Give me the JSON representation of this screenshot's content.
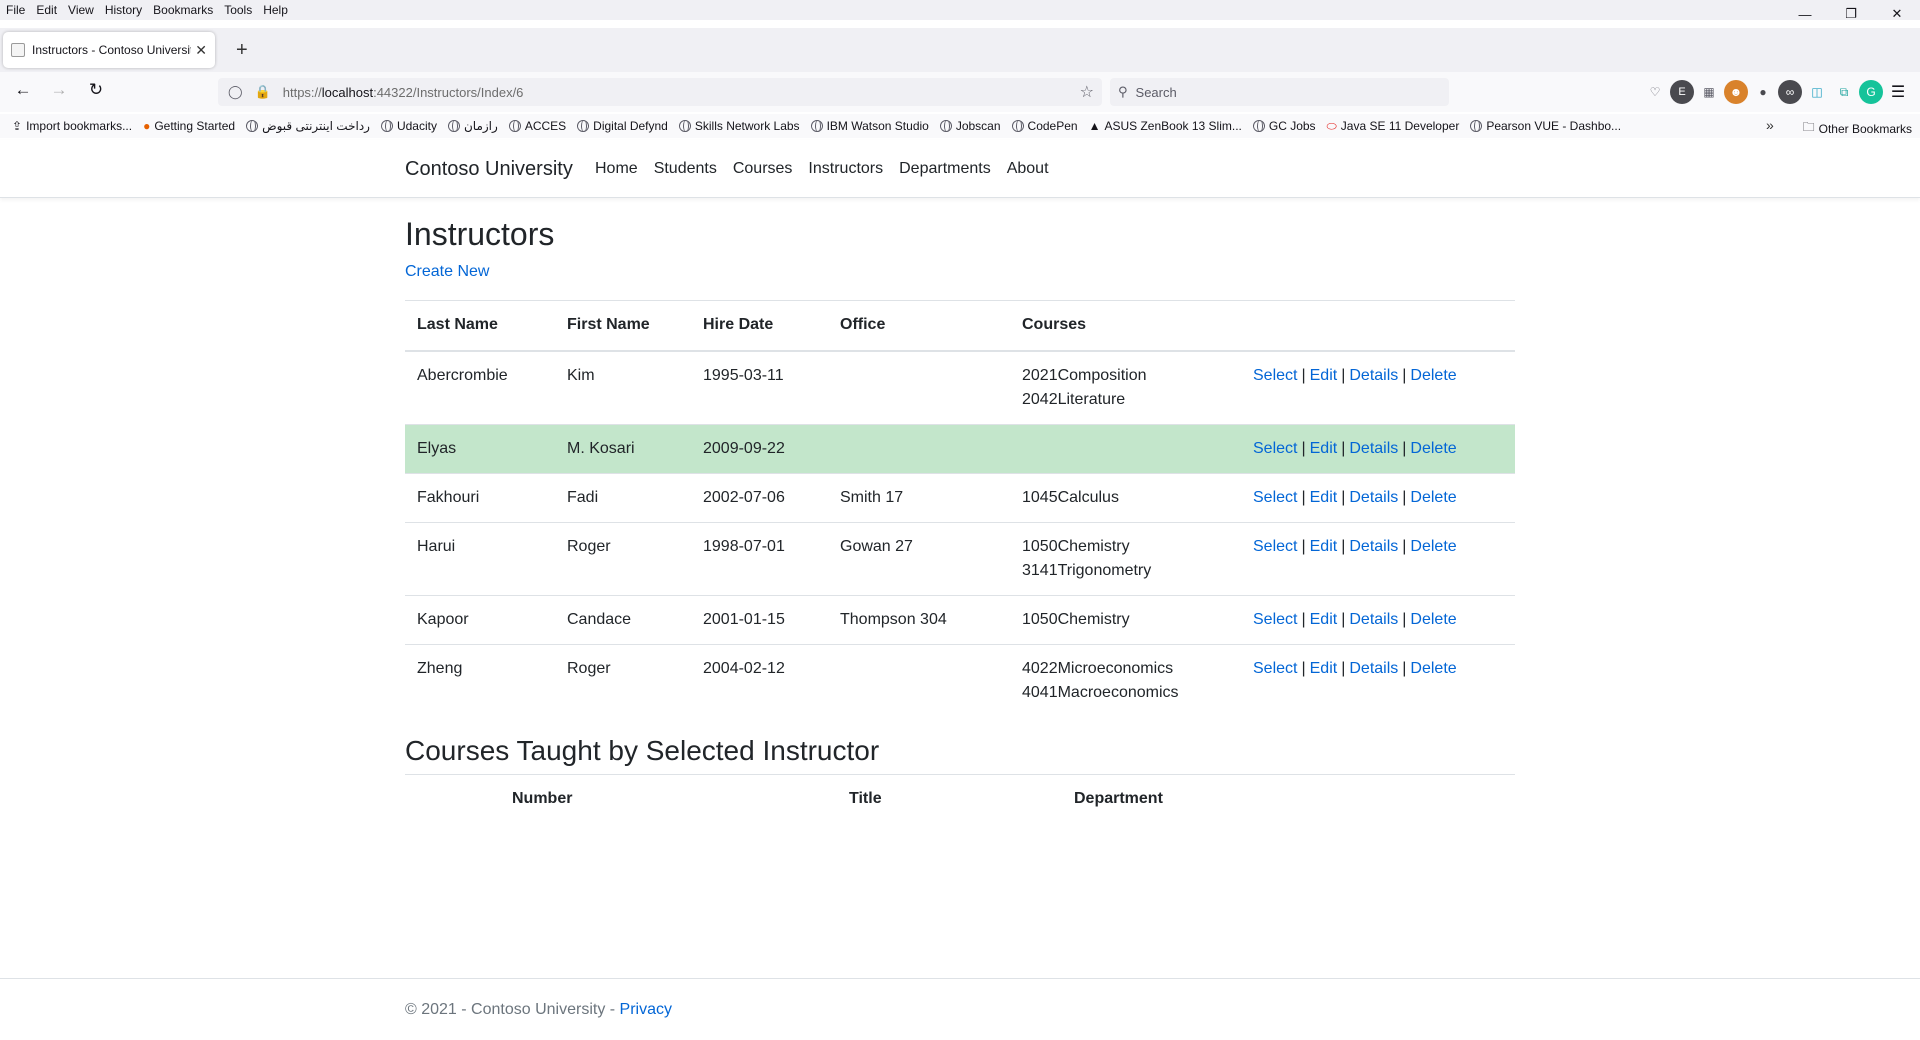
{
  "browser": {
    "menu": [
      "File",
      "Edit",
      "View",
      "History",
      "Bookmarks",
      "Tools",
      "Help"
    ],
    "tab_title": "Instructors - Contoso University",
    "url_prefix": "https://",
    "url_host": "localhost",
    "url_rest": ":44322/Instructors/Index/6",
    "search_placeholder": "Search",
    "bookmarks": [
      "Import bookmarks...",
      "Getting Started",
      "رداخت اینترنتی قبوض",
      "Udacity",
      "رازمان",
      "ACCES",
      "Digital Defynd",
      "Skills Network Labs",
      "IBM Watson Studio",
      "Jobscan",
      "CodePen",
      "ASUS ZenBook 13 Slim...",
      "GC Jobs",
      "Java SE 11 Developer",
      "Pearson VUE - Dashbo..."
    ],
    "other_bookmarks": "Other Bookmarks"
  },
  "site": {
    "brand": "Contoso University",
    "nav": [
      "Home",
      "Students",
      "Courses",
      "Instructors",
      "Departments",
      "About"
    ]
  },
  "main": {
    "title": "Instructors",
    "create_new": "Create New",
    "columns": [
      "Last Name",
      "First Name",
      "Hire Date",
      "Office",
      "Courses"
    ],
    "action_labels": {
      "select": "Select",
      "edit": "Edit",
      "details": "Details",
      "delete": "Delete",
      "separator": "|"
    },
    "rows": [
      {
        "last": "Abercrombie",
        "first": "Kim",
        "hire": "1995-03-11",
        "office": "",
        "courses": [
          "2021Composition",
          "2042Literature"
        ],
        "selected": false
      },
      {
        "last": "Elyas",
        "first": "M. Kosari",
        "hire": "2009-09-22",
        "office": "",
        "courses": [],
        "selected": true
      },
      {
        "last": "Fakhouri",
        "first": "Fadi",
        "hire": "2002-07-06",
        "office": "Smith 17",
        "courses": [
          "1045Calculus"
        ],
        "selected": false
      },
      {
        "last": "Harui",
        "first": "Roger",
        "hire": "1998-07-01",
        "office": "Gowan 27",
        "courses": [
          "1050Chemistry",
          "3141Trigonometry"
        ],
        "selected": false
      },
      {
        "last": "Kapoor",
        "first": "Candace",
        "hire": "2001-01-15",
        "office": "Thompson 304",
        "courses": [
          "1050Chemistry"
        ],
        "selected": false
      },
      {
        "last": "Zheng",
        "first": "Roger",
        "hire": "2004-02-12",
        "office": "",
        "courses": [
          "4022Microeconomics",
          "4041Macroeconomics"
        ],
        "selected": false
      }
    ],
    "courses_section": {
      "title": "Courses Taught by Selected Instructor",
      "columns": [
        "Number",
        "Title",
        "Department"
      ]
    }
  },
  "footer": {
    "text": "© 2021 - Contoso University - ",
    "privacy": "Privacy"
  },
  "colors": {
    "link": "#0366d6",
    "selected_row": "#c3e6cb",
    "border": "#dee2e6"
  }
}
